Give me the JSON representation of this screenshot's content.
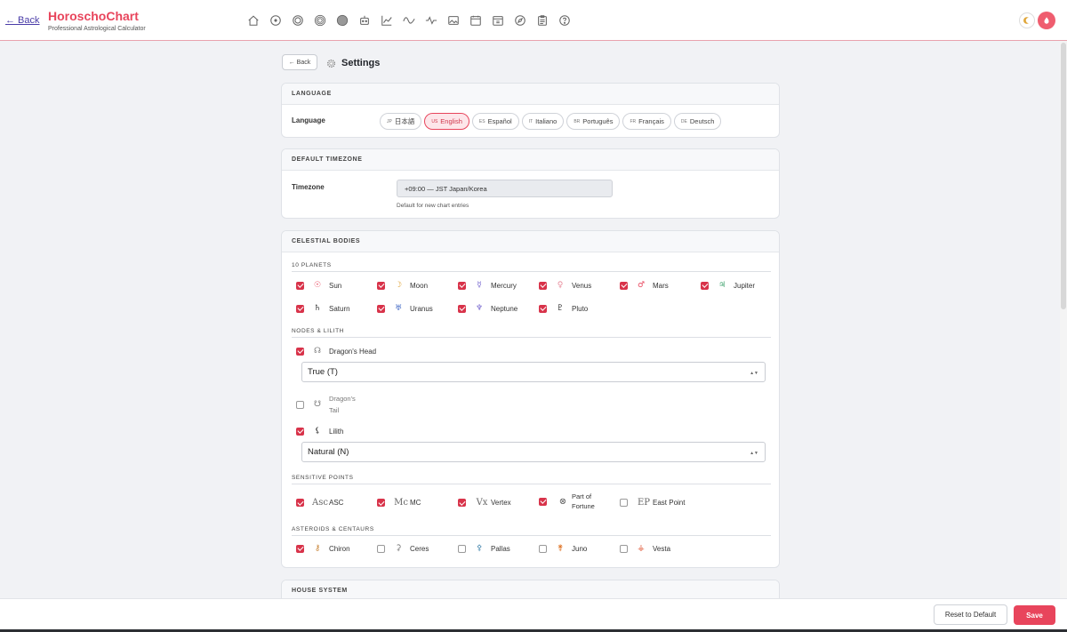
{
  "header": {
    "back_label": "← Back",
    "title": "HoroschoChart",
    "subtitle": "Professional Astrological Calculator",
    "nav_icons": [
      "home-icon",
      "sun-chart-icon",
      "bi-wheel-icon",
      "tri-wheel-icon",
      "quad-wheel-icon",
      "robot-icon",
      "line-chart-icon",
      "wave-icon",
      "pulse-icon",
      "image-icon",
      "calendar-icon",
      "calendar-mini-icon",
      "compass-icon",
      "clipboard-icon",
      "help-icon"
    ]
  },
  "page": {
    "back_label": "← Back",
    "title": "Settings"
  },
  "language": {
    "section_title": "LANGUAGE",
    "row_label": "Language",
    "options": [
      {
        "code": "JP",
        "label": "日本語",
        "active": false
      },
      {
        "code": "US",
        "label": "English",
        "active": true
      },
      {
        "code": "ES",
        "label": "Español",
        "active": false
      },
      {
        "code": "IT",
        "label": "Italiano",
        "active": false
      },
      {
        "code": "BR",
        "label": "Português",
        "active": false
      },
      {
        "code": "FR",
        "label": "Français",
        "active": false
      },
      {
        "code": "DE",
        "label": "Deutsch",
        "active": false
      }
    ]
  },
  "timezone": {
    "section_title": "DEFAULT TIMEZONE",
    "row_label": "Timezone",
    "value": "+09:00 — JST Japan/Korea",
    "hint": "Default for new chart entries"
  },
  "celestial": {
    "section_title": "CELESTIAL BODIES",
    "planets_title": "10 PLANETS",
    "planets": [
      {
        "name": "Sun",
        "glyph": "☉",
        "color": "#e8455c",
        "checked": true
      },
      {
        "name": "Moon",
        "glyph": "☽",
        "color": "#e0a63a",
        "checked": true
      },
      {
        "name": "Mercury",
        "glyph": "☿",
        "color": "#7a6bd0",
        "checked": true
      },
      {
        "name": "Venus",
        "glyph": "♀",
        "color": "#e88a9a",
        "checked": true
      },
      {
        "name": "Mars",
        "glyph": "♂",
        "color": "#e8455c",
        "checked": true
      },
      {
        "name": "Jupiter",
        "glyph": "♃",
        "color": "#3aa06a",
        "checked": true
      },
      {
        "name": "Saturn",
        "glyph": "♄",
        "color": "#333333",
        "checked": true
      },
      {
        "name": "Uranus",
        "glyph": "♅",
        "color": "#4a6fc8",
        "checked": true
      },
      {
        "name": "Neptune",
        "glyph": "♆",
        "color": "#7a6bd0",
        "checked": true
      },
      {
        "name": "Pluto",
        "glyph": "♇",
        "color": "#333333",
        "checked": true
      }
    ],
    "nodes_title": "NODES & LILITH",
    "dragon_head": {
      "name": "Dragon's Head",
      "glyph": "☊",
      "checked": true,
      "select": "True (T)"
    },
    "dragon_tail": {
      "name_line1": "Dragon's",
      "name_line2": "Tail",
      "glyph": "☋",
      "checked": false
    },
    "lilith": {
      "name": "Lilith",
      "glyph": "⚸",
      "checked": true,
      "select": "Natural (N)"
    },
    "sensitive_title": "SENSITIVE POINTS",
    "sensitive": [
      {
        "name": "ASC",
        "glyph": "Asc",
        "checked": true
      },
      {
        "name": "MC",
        "glyph": "Mc",
        "checked": true
      },
      {
        "name": "Vertex",
        "glyph": "Vx",
        "checked": true
      },
      {
        "name_line1": "Part of",
        "name_line2": "Fortune",
        "glyph": "⊗",
        "checked": true
      },
      {
        "name": "East Point",
        "glyph": "EP",
        "checked": false
      }
    ],
    "asteroids_title": "ASTEROIDS & CENTAURS",
    "asteroids": [
      {
        "name": "Chiron",
        "glyph": "⚷",
        "color": "#c9863a",
        "checked": true
      },
      {
        "name": "Ceres",
        "glyph": "⚳",
        "color": "#777777",
        "checked": false
      },
      {
        "name": "Pallas",
        "glyph": "⚴",
        "color": "#4a8ab0",
        "checked": false
      },
      {
        "name": "Juno",
        "glyph": "⚵",
        "color": "#e07a30",
        "checked": false
      },
      {
        "name": "Vesta",
        "glyph": "⚶",
        "color": "#e05a3a",
        "checked": false
      }
    ]
  },
  "house": {
    "section_title": "HOUSE SYSTEM"
  },
  "footer": {
    "reset_label": "Reset to Default",
    "save_label": "Save"
  },
  "colors": {
    "accent": "#e8455c",
    "checkbox": "#d8334a"
  }
}
